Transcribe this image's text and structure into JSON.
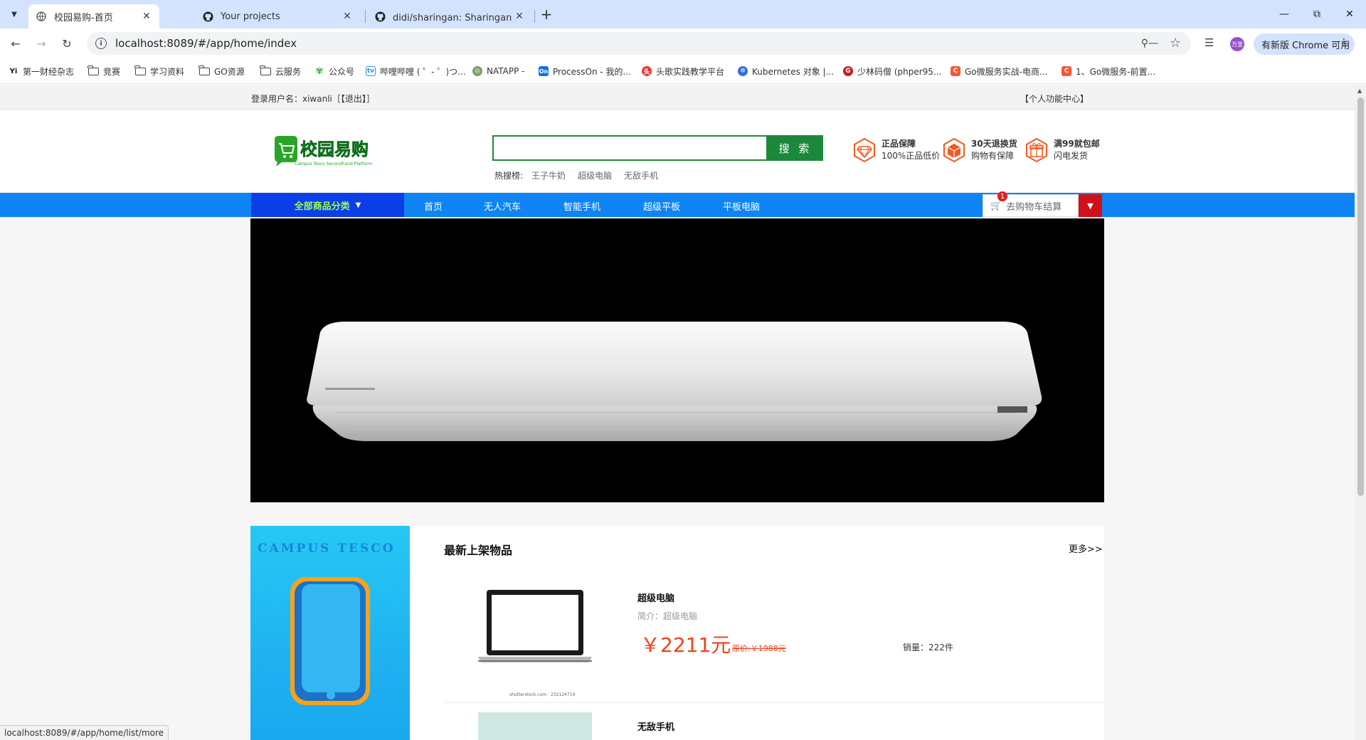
{
  "browser": {
    "tabs": [
      {
        "title": "校园易购-首页",
        "active": true
      },
      {
        "title": "Your projects",
        "active": false
      },
      {
        "title": "didi/sharingan: Sharingan（",
        "active": false
      }
    ],
    "url": "localhost:8089/#/app/home/index",
    "update_label": "有新版 Chrome 可用",
    "profile_initials": "万里",
    "bookmarks": [
      {
        "label": "第一财经杂志",
        "icon": "yi-icon"
      },
      {
        "label": "竞赛",
        "icon": "folder-icon"
      },
      {
        "label": "学习资料",
        "icon": "folder-icon"
      },
      {
        "label": "GO资源",
        "icon": "folder-icon"
      },
      {
        "label": "云服务",
        "icon": "folder-icon"
      },
      {
        "label": "公众号",
        "icon": "wechat-icon"
      },
      {
        "label": "哔哩哔哩 ( ゜- ゜)つ...",
        "icon": "bilibili-icon"
      },
      {
        "label": "NATAPP -",
        "icon": "natapp-icon"
      },
      {
        "label": "ProcessOn - 我的...",
        "icon": "processon-icon"
      },
      {
        "label": "头歌实践教学平台",
        "icon": "educoder-icon"
      },
      {
        "label": "Kubernetes 对象 |...",
        "icon": "kubernetes-icon"
      },
      {
        "label": "少林码僧 (phper95...",
        "icon": "gitee-icon"
      },
      {
        "label": "Go微服务实战-电商...",
        "icon": "csdn-icon"
      },
      {
        "label": "1、Go微服务-前置...",
        "icon": "csdn-icon"
      }
    ],
    "status_url": "localhost:8089/#/app/home/list/more"
  },
  "topbar": {
    "login_text": "登录用户名：xiwanli［【退出】］",
    "user_center": "【个人功能中心】"
  },
  "header": {
    "logo_text": "校园易购",
    "logo_sub": "Campus Tesco Secondhand Platform",
    "search_button": "搜 索",
    "hot_label": "热搜榜:",
    "hot_words": [
      "王子牛奶",
      "超级电脑",
      "无敌手机"
    ],
    "promos": [
      {
        "title": "正品保障",
        "sub": "100%正品低价",
        "icon": "diamond-icon"
      },
      {
        "title": "30天退换货",
        "sub": "购物有保障",
        "icon": "box-icon"
      },
      {
        "title": "满99就包邮",
        "sub": "闪电发货",
        "icon": "gift-icon"
      }
    ]
  },
  "nav": {
    "category": "全部商品分类",
    "items": [
      "首页",
      "无人汽车",
      "智能手机",
      "超级平板",
      "平板电脑"
    ],
    "cart_label": "去购物车结算",
    "cart_count": "1"
  },
  "section": {
    "ad_title": "CAMPUS TESCO",
    "title": "最新上架物品",
    "more": "更多>>",
    "items": [
      {
        "name": "超级电脑",
        "intro": "简介：超级电脑",
        "price": "￥2211元",
        "old_price": "原价:￥1988元",
        "sales": "销量：222件",
        "watermark": "shutterstock.com · 232124719"
      },
      {
        "name": "无敌手机"
      }
    ]
  },
  "colors": {
    "nav_blue": "#0e84f5",
    "category_blue": "#0c3ee8",
    "search_green": "#1a8a3a",
    "price_red": "#f1401a",
    "cart_red": "#d0111c"
  }
}
